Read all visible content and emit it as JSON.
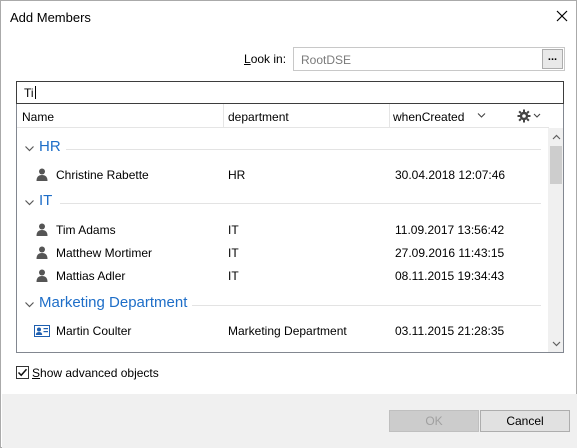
{
  "window": {
    "title": "Add Members"
  },
  "look_in": {
    "label_prefix": "",
    "label_access": "L",
    "label_rest": "ook in:",
    "value": "RootDSE",
    "browse_label": "..."
  },
  "search": {
    "value": "Ti"
  },
  "columns": {
    "name": "Name",
    "department": "department",
    "when_created": "whenCreated"
  },
  "groups": [
    {
      "name": "HR",
      "rows": [
        {
          "icon": "user-icon",
          "name": "Christine Rabette",
          "department": "HR",
          "when_created": "30.04.2018 12:07:46"
        }
      ]
    },
    {
      "name": "IT",
      "rows": [
        {
          "icon": "user-icon",
          "name": "Tim Adams",
          "department": "IT",
          "when_created": "11.09.2017 13:56:42"
        },
        {
          "icon": "user-icon",
          "name": "Matthew Mortimer",
          "department": "IT",
          "when_created": "27.09.2016 11:43:15"
        },
        {
          "icon": "user-icon",
          "name": "Mattias Adler",
          "department": "IT",
          "when_created": "08.11.2015 19:34:43"
        }
      ]
    },
    {
      "name": "Marketing Department",
      "rows": [
        {
          "icon": "contact-card-icon",
          "name": "Martin Coulter",
          "department": "Marketing Department",
          "when_created": "03.11.2015 21:28:35"
        }
      ]
    }
  ],
  "show_advanced": {
    "checked": true,
    "label_access": "S",
    "label_rest": "how advanced objects"
  },
  "buttons": {
    "ok": "OK",
    "cancel": "Cancel"
  },
  "colors": {
    "group_header": "#1e6ec8",
    "footer_bg": "#f0f0f0"
  }
}
